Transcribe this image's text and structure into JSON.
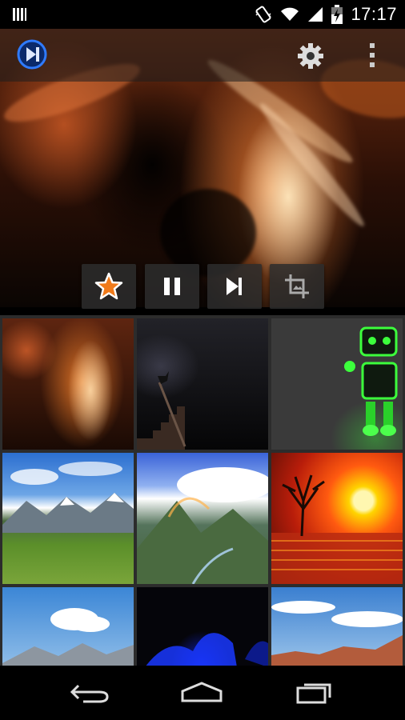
{
  "status_bar": {
    "time": "17:17",
    "icons": [
      "notification-bars-icon",
      "vibrate-icon",
      "wifi-icon",
      "cell-signal-icon",
      "battery-charging-icon"
    ]
  },
  "toolbar": {
    "app_icon": "play-skip-icon",
    "settings_icon": "gear-icon",
    "overflow_icon": "overflow-menu-icon"
  },
  "controls": [
    {
      "name": "favorite",
      "icon": "star-icon",
      "accent": "#f07a1a"
    },
    {
      "name": "pause",
      "icon": "pause-icon"
    },
    {
      "name": "next",
      "icon": "skip-next-icon"
    },
    {
      "name": "crop",
      "icon": "crop-icon"
    }
  ],
  "gallery": [
    {
      "name": "antelope-canyon",
      "colors": [
        "#e47a2c",
        "#1a0a04"
      ]
    },
    {
      "name": "dark-stairs-cat",
      "colors": [
        "#3a3a48",
        "#0a0a0c"
      ]
    },
    {
      "name": "green-robot",
      "colors": [
        "#39ff39",
        "#3a3a3a"
      ]
    },
    {
      "name": "mountain-meadow",
      "colors": [
        "#2c6fd0",
        "#5b8f2a"
      ]
    },
    {
      "name": "rainbow-valley",
      "colors": [
        "#3a63d8",
        "#4e6a3e"
      ]
    },
    {
      "name": "sunset-tree",
      "colors": [
        "#ff3a10",
        "#f7c400"
      ]
    },
    {
      "name": "snowy-peaks",
      "colors": [
        "#3b86d6",
        "#c9d3db"
      ]
    },
    {
      "name": "blue-cave",
      "colors": [
        "#1a3cff",
        "#05050a"
      ]
    },
    {
      "name": "red-rocks-sky",
      "colors": [
        "#3a7fd0",
        "#b35c3c"
      ]
    }
  ],
  "navbar": {
    "back_icon": "back-icon",
    "home_icon": "home-icon",
    "recents_icon": "recents-icon"
  }
}
